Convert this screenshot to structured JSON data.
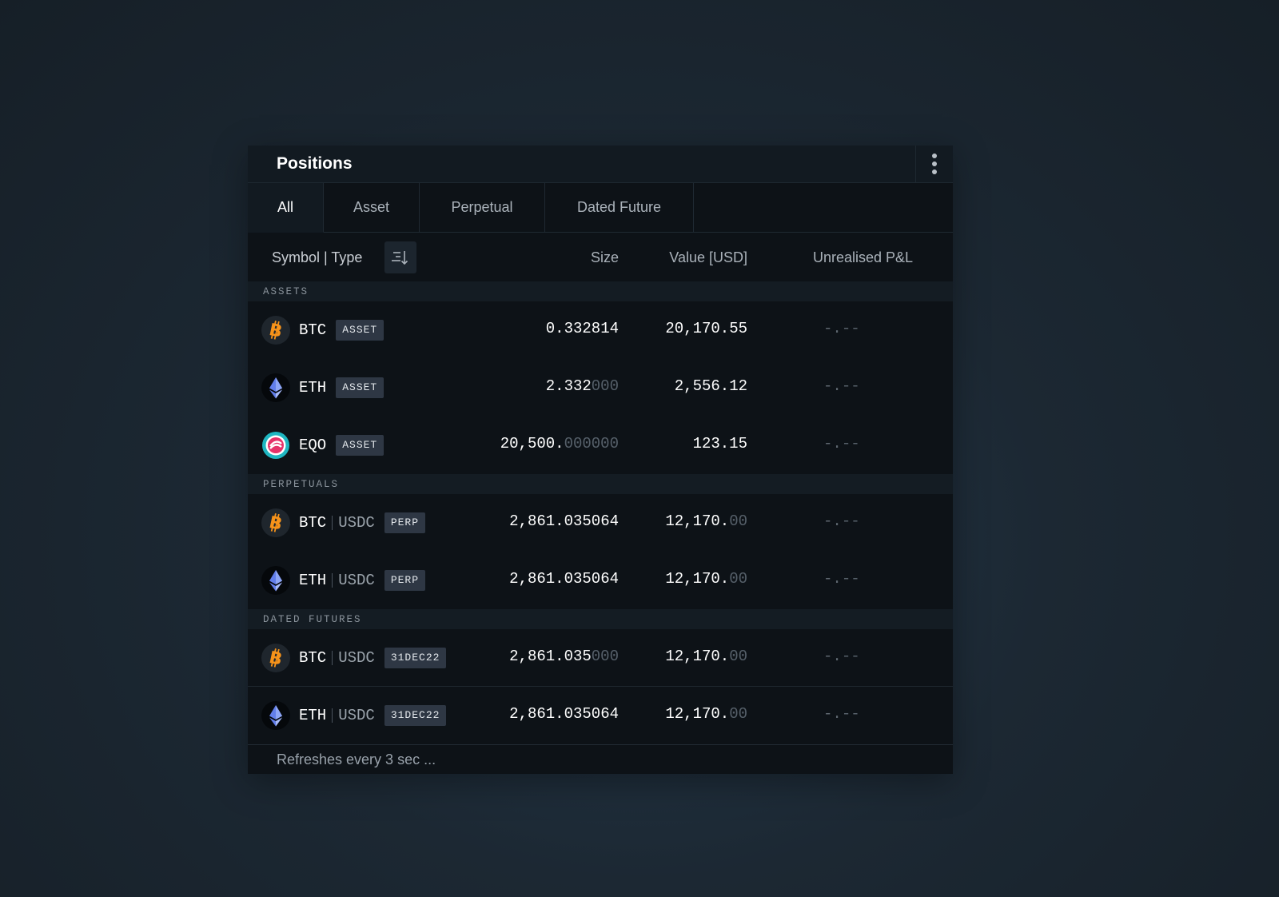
{
  "panel": {
    "title": "Positions"
  },
  "tabs": [
    {
      "label": "All",
      "active": true
    },
    {
      "label": "Asset",
      "active": false
    },
    {
      "label": "Perpetual",
      "active": false
    },
    {
      "label": "Dated Future",
      "active": false
    }
  ],
  "columns": {
    "symbol_type": "Symbol | Type",
    "size": "Size",
    "value": "Value [USD]",
    "pnl": "Unrealised P&L"
  },
  "sections": {
    "assets": "ASSETS",
    "perpetuals": "PERPETUALS",
    "dated_futures": "DATED FUTURES"
  },
  "assets": [
    {
      "icon": "bitcoin-icon",
      "symbol": "BTC",
      "badge": "ASSET",
      "size_main": "0.332814",
      "size_dim": "",
      "value_main": "20,170.55",
      "value_dim": "",
      "pnl_main": "-.",
      "pnl_dim": "--"
    },
    {
      "icon": "ethereum-icon",
      "symbol": "ETH",
      "badge": "ASSET",
      "size_main": "2.332",
      "size_dim": "000",
      "value_main": "2,556.12",
      "value_dim": "",
      "pnl_main": "-.",
      "pnl_dim": "--"
    },
    {
      "icon": "eqo-icon",
      "symbol": "EQO",
      "badge": "ASSET",
      "size_main": "20,500.",
      "size_dim": "000000",
      "value_main": "123.15",
      "value_dim": "",
      "pnl_main": "-.",
      "pnl_dim": "--"
    }
  ],
  "perpetuals": [
    {
      "icon": "bitcoin-icon",
      "symbol": "BTC",
      "quote": "USDC",
      "badge": "PERP",
      "size_main": "2,861.035064",
      "size_dim": "",
      "value_main": "12,170.",
      "value_dim": "00",
      "pnl_main": "-.",
      "pnl_dim": "--"
    },
    {
      "icon": "ethereum-icon",
      "symbol": "ETH",
      "quote": "USDC",
      "badge": "PERP",
      "size_main": "2,861.035064",
      "size_dim": "",
      "value_main": "12,170.",
      "value_dim": "00",
      "pnl_main": "-.",
      "pnl_dim": "--"
    }
  ],
  "dated_futures": [
    {
      "icon": "bitcoin-icon",
      "symbol": "BTC",
      "quote": "USDC",
      "badge": "31DEC22",
      "size_main": "2,861.035",
      "size_dim": "000",
      "value_main": "12,170.",
      "value_dim": "00",
      "pnl_main": "-.",
      "pnl_dim": "--"
    },
    {
      "icon": "ethereum-icon",
      "symbol": "ETH",
      "quote": "USDC",
      "badge": "31DEC22",
      "size_main": "2,861.035064",
      "size_dim": "",
      "value_main": "12,170.",
      "value_dim": "00",
      "pnl_main": "-.",
      "pnl_dim": "--"
    }
  ],
  "footer": {
    "text": "Refreshes every 3 sec ..."
  },
  "colors": {
    "bitcoin": "#f7931a",
    "ethereum": "#627eea",
    "eqo_ring": "#1fb6c1",
    "eqo_mark": "#e5336a"
  }
}
